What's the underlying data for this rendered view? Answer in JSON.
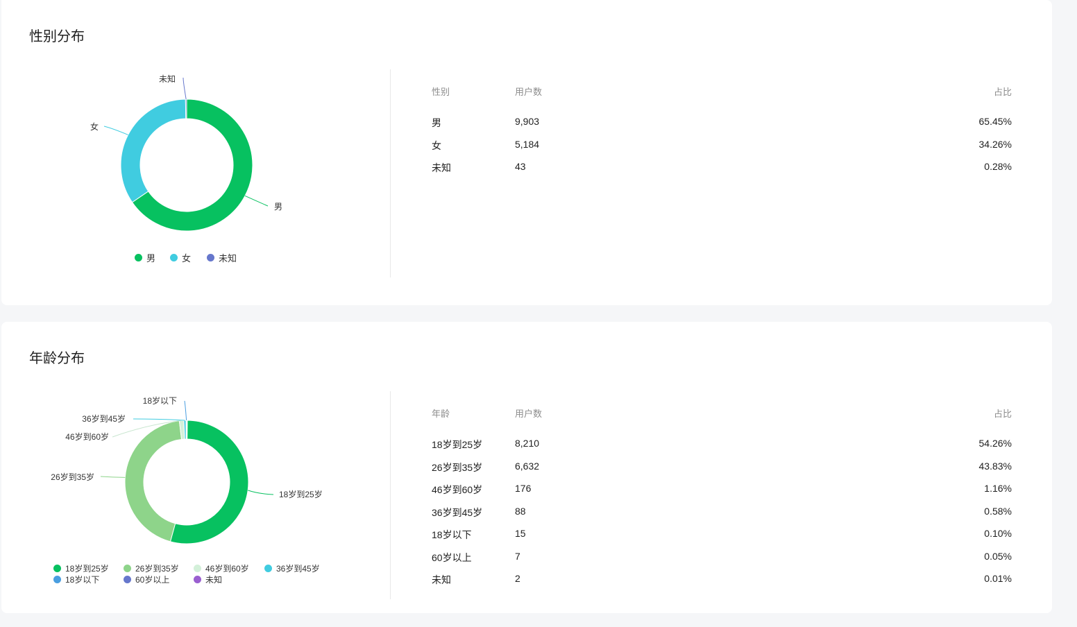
{
  "gender": {
    "title": "性别分布",
    "table": {
      "headers": [
        "性别",
        "用户数",
        "占比"
      ],
      "rows": [
        [
          "男",
          "9,903",
          "65.45%"
        ],
        [
          "女",
          "5,184",
          "34.26%"
        ],
        [
          "未知",
          "43",
          "0.28%"
        ]
      ]
    },
    "legend": [
      {
        "label": "男",
        "color": "#07c160"
      },
      {
        "label": "女",
        "color": "#40cce0"
      },
      {
        "label": "未知",
        "color": "#6677cc"
      }
    ]
  },
  "age": {
    "title": "年龄分布",
    "table": {
      "headers": [
        "年龄",
        "用户数",
        "占比"
      ],
      "rows": [
        [
          "18岁到25岁",
          "8,210",
          "54.26%"
        ],
        [
          "26岁到35岁",
          "6,632",
          "43.83%"
        ],
        [
          "46岁到60岁",
          "176",
          "1.16%"
        ],
        [
          "36岁到45岁",
          "88",
          "0.58%"
        ],
        [
          "18岁以下",
          "15",
          "0.10%"
        ],
        [
          "60岁以上",
          "7",
          "0.05%"
        ],
        [
          "未知",
          "2",
          "0.01%"
        ]
      ]
    },
    "legend": [
      {
        "label": "18岁到25岁",
        "color": "#07c160"
      },
      {
        "label": "26岁到35岁",
        "color": "#8ed48a"
      },
      {
        "label": "46岁到60岁",
        "color": "#d3f0d9"
      },
      {
        "label": "36岁到45岁",
        "color": "#40cce0"
      },
      {
        "label": "18岁以下",
        "color": "#4a9ee0"
      },
      {
        "label": "60岁以上",
        "color": "#6677cc"
      },
      {
        "label": "未知",
        "color": "#9a5fd0"
      }
    ]
  },
  "chart_data": [
    {
      "type": "pie",
      "title": "性别分布",
      "categories": [
        "男",
        "女",
        "未知"
      ],
      "values": [
        9903,
        5184,
        43
      ],
      "colors": [
        "#07c160",
        "#40cce0",
        "#6677cc"
      ],
      "legend_position": "bottom"
    },
    {
      "type": "pie",
      "title": "年龄分布",
      "categories": [
        "18岁到25岁",
        "26岁到35岁",
        "46岁到60岁",
        "36岁到45岁",
        "18岁以下",
        "60岁以上",
        "未知"
      ],
      "values": [
        8210,
        6632,
        176,
        88,
        15,
        7,
        2
      ],
      "colors": [
        "#07c160",
        "#8ed48a",
        "#d3f0d9",
        "#40cce0",
        "#4a9ee0",
        "#6677cc",
        "#9a5fd0"
      ],
      "legend_position": "bottom"
    }
  ]
}
